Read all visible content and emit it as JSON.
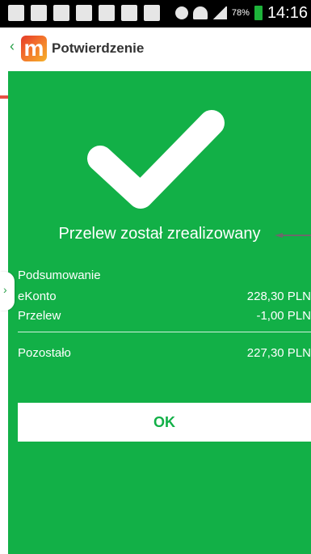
{
  "status_bar": {
    "battery_percent": "78%",
    "time": "14:16",
    "battery_color": "#1db33a"
  },
  "app_bar": {
    "title": "Potwierdzenie",
    "logo_letter": "m",
    "back_icon": "chevron-left-icon"
  },
  "colors": {
    "panel": "#12b047",
    "button_text": "#12b047"
  },
  "result": {
    "title": "Przelew został zrealizowany"
  },
  "summary": {
    "title": "Podsumowanie",
    "rows": [
      {
        "label": "eKonto",
        "value": "228,30 PLN"
      },
      {
        "label": "Przelew",
        "value": "-1,00 PLN"
      }
    ],
    "remaining": {
      "label": "Pozostało",
      "value": "227,30 PLN"
    }
  },
  "actions": {
    "ok_label": "OK"
  }
}
